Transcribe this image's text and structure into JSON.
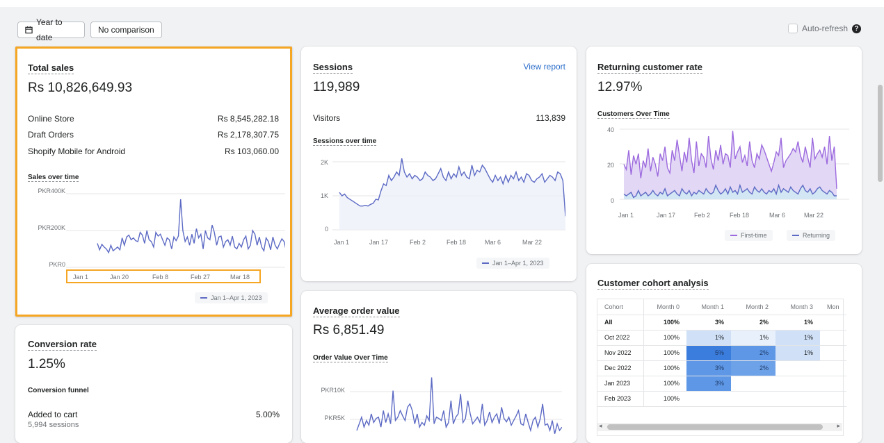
{
  "toolbar": {
    "date_label": "Year to date",
    "compare_label": "No comparison",
    "autorefresh_label": "Auto-refresh",
    "help_glyph": "?"
  },
  "colors": {
    "accent": "#5c6ac4",
    "returning": "#47c1bf",
    "first_time": "#9c6ade",
    "selection": "#f5a623",
    "link": "#2c6ecb"
  },
  "total_sales": {
    "title": "Total sales",
    "value": "Rs 10,826,649.93",
    "rows": [
      {
        "label": "Online Store",
        "value": "Rs 8,545,282.18"
      },
      {
        "label": "Draft Orders",
        "value": "Rs 2,178,307.75"
      },
      {
        "label": "Shopify Mobile for Android",
        "value": "Rs 103,060.00"
      }
    ],
    "chart_title": "Sales over time",
    "legend": "Jan 1–Apr 1, 2023"
  },
  "sessions": {
    "title": "Sessions",
    "link": "View report",
    "value": "119,989",
    "visitors_label": "Visitors",
    "visitors_value": "113,839",
    "chart_title": "Sessions over time",
    "legend": "Jan 1–Apr 1, 2023"
  },
  "returning": {
    "title": "Returning customer rate",
    "value": "12.97%",
    "chart_title": "Customers Over Time",
    "legend_first": "First-time",
    "legend_returning": "Returning"
  },
  "conversion": {
    "title": "Conversion rate",
    "value": "1.25%",
    "funnel_title": "Conversion funnel",
    "row_label": "Added to cart",
    "row_sub": "5,994 sessions",
    "row_value": "5.00%"
  },
  "aov": {
    "title": "Average order value",
    "value": "Rs 6,851.49",
    "chart_title": "Order Value Over Time"
  },
  "cohort": {
    "title": "Customer cohort analysis",
    "headers": [
      "Cohort",
      "Month 0",
      "Month 1",
      "Month 2",
      "Month 3",
      "Mon"
    ],
    "rows": [
      {
        "label": "All",
        "cells": [
          "100%",
          "3%",
          "2%",
          "1%",
          ""
        ]
      },
      {
        "label": "Oct 2022",
        "cells": [
          "100%",
          "1%",
          "1%",
          "1%",
          ""
        ]
      },
      {
        "label": "Nov 2022",
        "cells": [
          "100%",
          "5%",
          "2%",
          "1%",
          ""
        ]
      },
      {
        "label": "Dec 2022",
        "cells": [
          "100%",
          "3%",
          "2%",
          "",
          ""
        ]
      },
      {
        "label": "Jan 2023",
        "cells": [
          "100%",
          "3%",
          "",
          "",
          ""
        ]
      },
      {
        "label": "Feb 2023",
        "cells": [
          "100%",
          "",
          "",
          "",
          ""
        ]
      }
    ],
    "scroll_left": "◂",
    "scroll_right": "▸"
  },
  "chart_data": [
    {
      "type": "line",
      "title": "Sales over time",
      "x_ticks": [
        "Jan 1",
        "Jan 20",
        "Feb 8",
        "Feb 27",
        "Mar 18"
      ],
      "y_ticks": [
        "PKR400K",
        "PKR200K",
        "PKR0"
      ],
      "ylim": [
        0,
        400000
      ],
      "series": [
        {
          "name": "Jan 1–Apr 1, 2023",
          "values": [
            130000,
            95000,
            125000,
            110000,
            100000,
            80000,
            120000,
            90000,
            100000,
            110000,
            95000,
            160000,
            120000,
            165000,
            175000,
            150000,
            160000,
            145000,
            140000,
            190000,
            175000,
            130000,
            200000,
            150000,
            140000,
            110000,
            190000,
            170000,
            180000,
            150000,
            120000,
            160000,
            150000,
            100000,
            165000,
            145000,
            170000,
            370000,
            200000,
            140000,
            165000,
            120000,
            180000,
            130000,
            210000,
            160000,
            180000,
            100000,
            200000,
            160000,
            150000,
            230000,
            190000,
            120000,
            165000,
            170000,
            110000,
            140000,
            150000,
            120000,
            170000,
            110000,
            100000,
            130000,
            110000,
            150000,
            170000,
            100000,
            120000,
            200000,
            180000,
            120000,
            165000,
            110000,
            90000,
            160000,
            140000,
            95000,
            165000,
            120000,
            100000,
            130000,
            155000,
            140000,
            85000,
            60000
          ]
        }
      ]
    },
    {
      "type": "line",
      "title": "Sessions over time",
      "x_ticks": [
        "Jan 1",
        "Jan 17",
        "Feb 2",
        "Feb 18",
        "Mar 6",
        "Mar 22"
      ],
      "y_ticks": [
        "2K",
        "1K",
        "0"
      ],
      "ylim": [
        0,
        2000
      ],
      "series": [
        {
          "name": "Jan 1–Apr 1, 2023",
          "values": [
            1100,
            1000,
            1050,
            950,
            900,
            850,
            800,
            750,
            700,
            700,
            720,
            700,
            750,
            780,
            900,
            880,
            1150,
            1350,
            1300,
            1600,
            1450,
            1550,
            1700,
            1600,
            2100,
            1700,
            1550,
            1650,
            1500,
            1600,
            1550,
            1450,
            1500,
            1700,
            1600,
            1550,
            1450,
            1500,
            1650,
            1800,
            1550,
            1450,
            1700,
            1500,
            1650,
            1550,
            1850,
            1600,
            1700,
            1550,
            1500,
            1900,
            1600,
            1750,
            1700,
            1900,
            1800,
            1650,
            1500,
            1400,
            1600,
            1450,
            1550,
            1350,
            1600,
            1400,
            1600,
            1500,
            1700,
            1450,
            1550,
            1400,
            1650,
            1600,
            1450,
            1400,
            1500,
            1550,
            1650,
            1400,
            1500,
            1600,
            1550,
            1450,
            1700,
            1650,
            1450,
            400
          ]
        }
      ]
    },
    {
      "type": "area",
      "title": "Customers Over Time",
      "x_ticks": [
        "Jan 1",
        "Jan 17",
        "Feb 2",
        "Feb 18",
        "Mar 6",
        "Mar 22"
      ],
      "y_ticks": [
        "40",
        "20",
        "0"
      ],
      "ylim": [
        0,
        40
      ],
      "series": [
        {
          "name": "First-time",
          "values": [
            20,
            17,
            28,
            14,
            25,
            20,
            26,
            12,
            22,
            18,
            29,
            16,
            24,
            20,
            13,
            26,
            22,
            30,
            18,
            15,
            28,
            22,
            34,
            25,
            16,
            27,
            21,
            35,
            22,
            15,
            33,
            19,
            26,
            24,
            18,
            36,
            23,
            17,
            28,
            22,
            31,
            20,
            26,
            25,
            18,
            39,
            23,
            27,
            30,
            21,
            25,
            19,
            33,
            22,
            18,
            26,
            23,
            31,
            28,
            24,
            20,
            16,
            21,
            27,
            25,
            35,
            18,
            22,
            24,
            26,
            29,
            27,
            33,
            25,
            21,
            30,
            24,
            18,
            35,
            23,
            26,
            28,
            24,
            30,
            20,
            36,
            22,
            30,
            6
          ]
        },
        {
          "name": "Returning",
          "values": [
            3,
            2,
            3,
            4,
            1,
            2,
            5,
            2,
            3,
            4,
            2,
            3,
            5,
            3,
            2,
            4,
            3,
            6,
            2,
            3,
            4,
            5,
            3,
            2,
            6,
            4,
            3,
            5,
            2,
            4,
            3,
            5,
            4,
            3,
            6,
            4,
            3,
            4,
            8,
            5,
            3,
            4,
            6,
            3,
            7,
            4,
            5,
            3,
            8,
            4,
            5,
            6,
            4,
            3,
            7,
            5,
            4,
            6,
            4,
            3,
            5,
            4,
            6,
            3,
            8,
            4,
            6,
            5,
            4,
            7,
            5,
            4,
            3,
            6,
            8,
            5,
            4,
            6,
            3,
            4,
            6,
            7,
            5,
            4,
            3,
            5,
            4,
            2,
            2
          ]
        }
      ]
    },
    {
      "type": "line",
      "title": "Order Value Over Time",
      "y_ticks": [
        "PKR10K",
        "PKR5K"
      ],
      "ylim": [
        3000,
        14000
      ],
      "series": [
        {
          "name": "Jan 1–Apr 1, 2023",
          "values": [
            5000,
            6000,
            7000,
            5500,
            6500,
            5800,
            7500,
            6200,
            6800,
            7000,
            5500,
            8000,
            6200,
            7500,
            6000,
            11000,
            6500,
            7000,
            8000,
            7200,
            6500,
            8500,
            9000,
            8000,
            6000,
            7500,
            5500,
            6200,
            5800,
            7200,
            6500,
            13000,
            6000,
            7000,
            6800,
            6500,
            8000,
            5500,
            6200,
            9500,
            6000,
            7000,
            7500,
            10500,
            6200,
            6800,
            9500,
            7500,
            6000,
            6500,
            7000,
            6200,
            9000,
            5800,
            6500,
            7800,
            6200,
            7000,
            7500,
            6000,
            8500,
            6800,
            6300,
            7000,
            5800,
            6500,
            7200,
            8000,
            6000,
            5800,
            7500,
            6200,
            5000,
            6500,
            7000,
            5500,
            6800,
            9000,
            5800,
            6000,
            5000,
            6500,
            4500,
            6000,
            5000,
            5500
          ]
        }
      ]
    }
  ]
}
